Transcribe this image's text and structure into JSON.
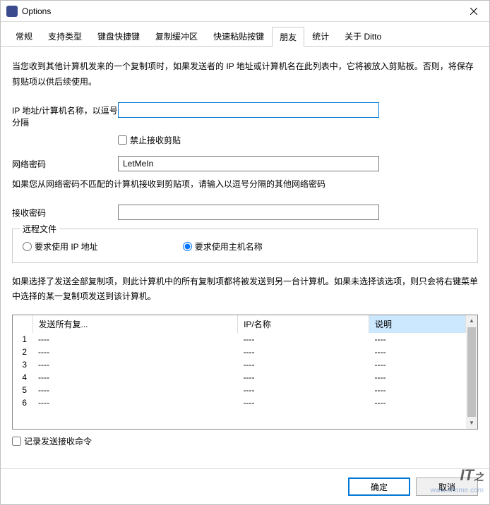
{
  "window": {
    "title": "Options"
  },
  "tabs": [
    {
      "label": "常规"
    },
    {
      "label": "支持类型"
    },
    {
      "label": "键盘快捷键"
    },
    {
      "label": "复制缓冲区"
    },
    {
      "label": "快速粘贴按键"
    },
    {
      "label": "朋友",
      "active": true
    },
    {
      "label": "统计"
    },
    {
      "label": "关于 Ditto"
    }
  ],
  "intro_desc": "当您收到其他计算机发来的一个复制项时，如果发送者的 IP 地址或计算机名在此列表中，它将被放入剪贴板。否则，将保存剪贴项以供后续使用。",
  "ip_label": "IP 地址/计算机名称，以逗号分隔",
  "ip_value": "",
  "block_recv_label": "禁止接收剪贴",
  "block_recv_checked": false,
  "net_pwd_label": "网络密码",
  "net_pwd_value": "LetMeIn",
  "net_pwd_hint": "如果您从网络密码不匹配的计算机接收到剪贴项，请输入以逗号分隔的其他网络密码",
  "recv_pwd_label": "接收密码",
  "recv_pwd_value": "",
  "remote_group": {
    "legend": "远程文件",
    "opt_ip": "要求使用 IP 地址",
    "opt_host": "要求使用主机名称",
    "selected": "host"
  },
  "desc2": "如果选择了发送全部复制项，则此计算机中的所有复制项都将被发送到另一台计算机。如果未选择该选项，则只会将右键菜单中选择的某一复制项发送到该计算机。",
  "table": {
    "headers": {
      "col1": "发送所有复...",
      "col2": "IP/名称",
      "col3": "说明"
    },
    "rows": [
      {
        "n": "1",
        "c1": "----",
        "c2": "----",
        "c3": "----"
      },
      {
        "n": "2",
        "c1": "----",
        "c2": "----",
        "c3": "----"
      },
      {
        "n": "3",
        "c1": "----",
        "c2": "----",
        "c3": "----"
      },
      {
        "n": "4",
        "c1": "----",
        "c2": "----",
        "c3": "----"
      },
      {
        "n": "5",
        "c1": "----",
        "c2": "----",
        "c3": "----"
      },
      {
        "n": "6",
        "c1": "----",
        "c2": "----",
        "c3": "----"
      }
    ]
  },
  "log_send_recv_label": "记录发送接收命令",
  "log_send_recv_checked": false,
  "buttons": {
    "ok": "确定",
    "cancel": "取消"
  },
  "watermark": {
    "main": "IT",
    "sub": "之",
    "url": "www.ithome.com"
  }
}
